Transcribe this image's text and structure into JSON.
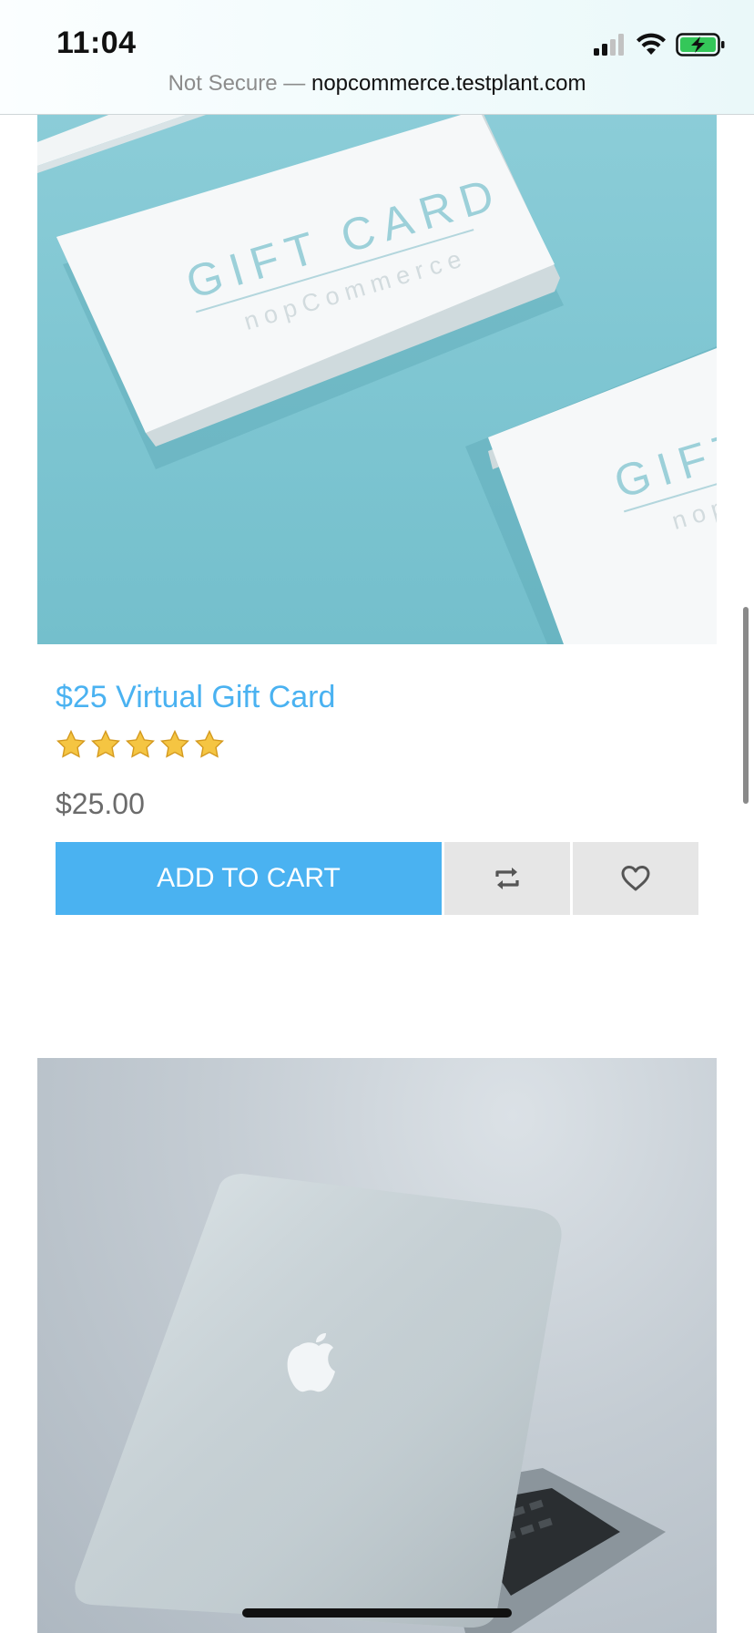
{
  "status_bar": {
    "time": "11:04",
    "icons": [
      "cellular-signal-icon",
      "wifi-icon",
      "battery-charging-icon"
    ]
  },
  "browser": {
    "security_label": "Not Secure —",
    "domain": "nopcommerce.testplant.com"
  },
  "products": [
    {
      "title": "$25 Virtual Gift Card",
      "rating": {
        "value": 5,
        "max": 5
      },
      "price": "$25.00",
      "image_text": {
        "heading": "GIFT CARD",
        "brand": "nopCommerce"
      },
      "actions": {
        "add_to_cart": "ADD TO CART",
        "compare_icon": "compare-arrows-icon",
        "wishlist_icon": "heart-icon"
      }
    }
  ],
  "colors": {
    "accent": "#4ab2f1",
    "star": "#f5c542",
    "icon_button_bg": "#e6e6e6",
    "price_text": "#6b6b6b"
  }
}
